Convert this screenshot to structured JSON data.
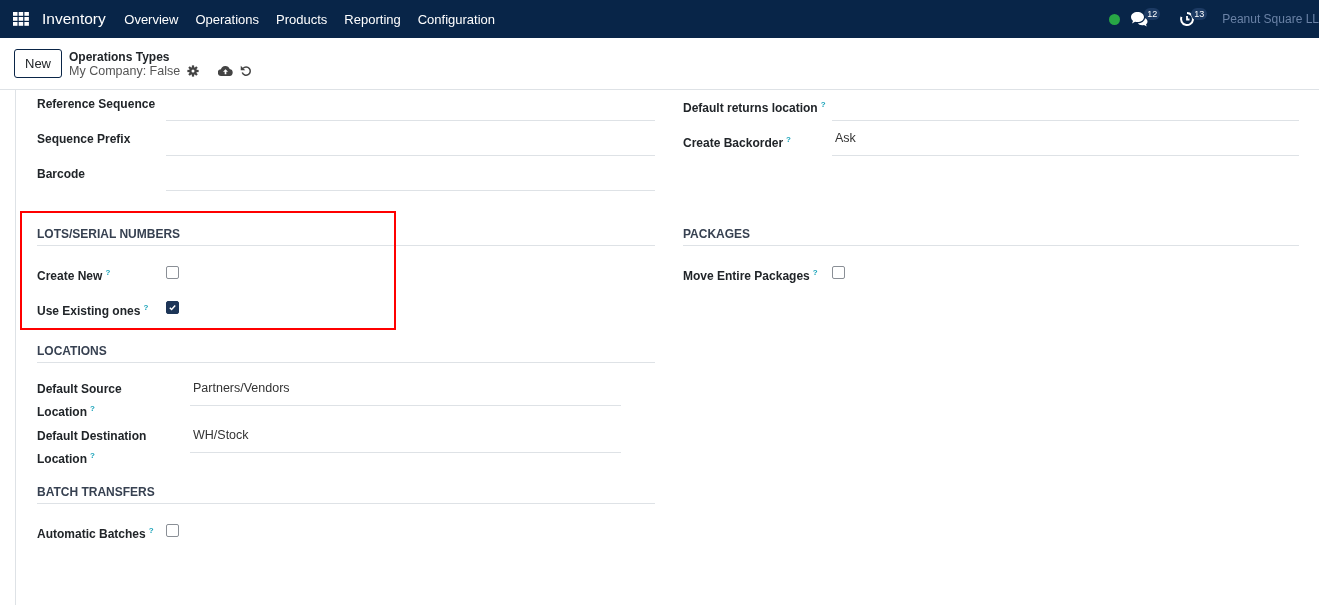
{
  "navbar": {
    "app": "Inventory",
    "menu": [
      "Overview",
      "Operations",
      "Products",
      "Reporting",
      "Configuration"
    ],
    "online": true,
    "messages": "12",
    "activities": "13",
    "company": "Peanut Square LL"
  },
  "control_panel": {
    "new_button": "New",
    "breadcrumb": "Operations Types",
    "record": "My Company: False"
  },
  "columns": [
    {
      "blocks": [
        {
          "kind": "fields",
          "highlighted": false,
          "fields": [
            {
              "kind": "text",
              "label": "Reference Sequence"
            },
            {
              "kind": "text",
              "label": "Sequence Prefix"
            },
            {
              "kind": "text",
              "label": "Barcode"
            }
          ]
        },
        {
          "kind": "section",
          "title": "LOTS/SERIAL NUMBERS",
          "highlighted": true,
          "fields": [
            {
              "kind": "checkbox",
              "label": "Create New",
              "help": "?",
              "checked": false
            },
            {
              "kind": "checkbox",
              "label": "Use Existing ones",
              "help": "?",
              "checked": true
            }
          ]
        },
        {
          "kind": "section",
          "title": "LOCATIONS",
          "highlighted": false,
          "fields": [
            {
              "kind": "text",
              "label": "Default Source Location",
              "help": "?",
              "value": "Partners/Vendors"
            },
            {
              "kind": "text",
              "label": "Default Destination Location",
              "help": "?",
              "value": "WH/Stock"
            }
          ]
        },
        {
          "kind": "section",
          "title": "BATCH TRANSFERS",
          "highlighted": false,
          "fields": [
            {
              "kind": "checkbox",
              "label": "Automatic Batches",
              "help": "?",
              "checked": false
            }
          ]
        }
      ]
    },
    {
      "blocks": [
        {
          "kind": "fields",
          "highlighted": false,
          "fields": [
            {
              "kind": "text",
              "label": "Default returns location",
              "help": "?"
            },
            {
              "kind": "text",
              "label": "Create Backorder",
              "help": "?",
              "value": "Ask"
            }
          ]
        },
        {
          "kind": "section",
          "title": "PACKAGES",
          "highlighted": false,
          "fields": [
            {
              "kind": "checkbox",
              "label": "Move Entire Packages",
              "help": "?",
              "checked": false
            }
          ]
        }
      ]
    }
  ]
}
